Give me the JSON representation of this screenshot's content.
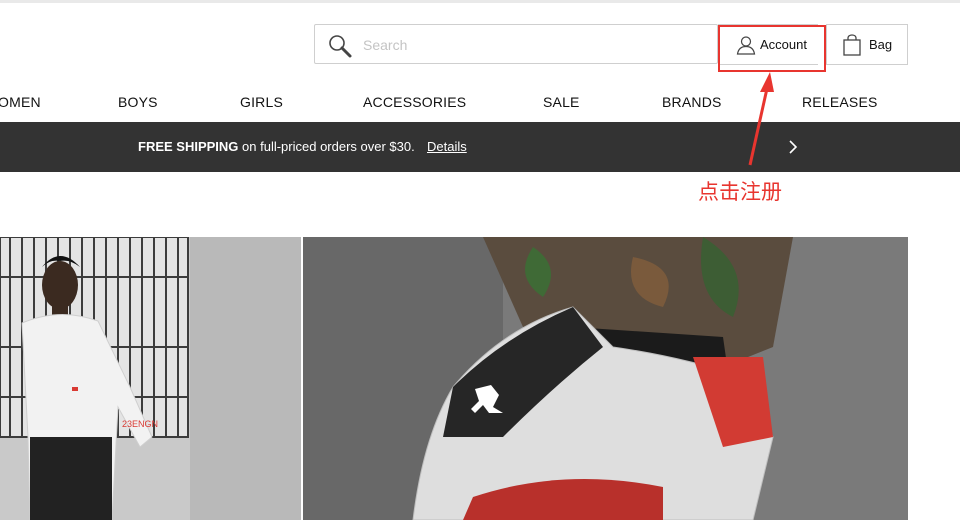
{
  "header": {
    "search": {
      "placeholder": "Search",
      "value": ""
    },
    "account_label": "Account",
    "bag_label": "Bag"
  },
  "nav": {
    "items": [
      {
        "label": "OMEN"
      },
      {
        "label": "BOYS"
      },
      {
        "label": "GIRLS"
      },
      {
        "label": "ACCESSORIES"
      },
      {
        "label": "SALE"
      },
      {
        "label": "BRANDS"
      },
      {
        "label": "RELEASES"
      }
    ]
  },
  "promo": {
    "strong": "FREE SHIPPING",
    "text": " on full-priced orders over $30.",
    "link": "Details"
  },
  "annotation": {
    "text": "点击注册",
    "color": "#e8352f"
  },
  "hero": {
    "left_image": "man-in-white-jacket-photo",
    "right_image": "sneaker-closeup-photo"
  },
  "colors": {
    "promo_bg": "#333333",
    "annotation_red": "#e8352f"
  }
}
